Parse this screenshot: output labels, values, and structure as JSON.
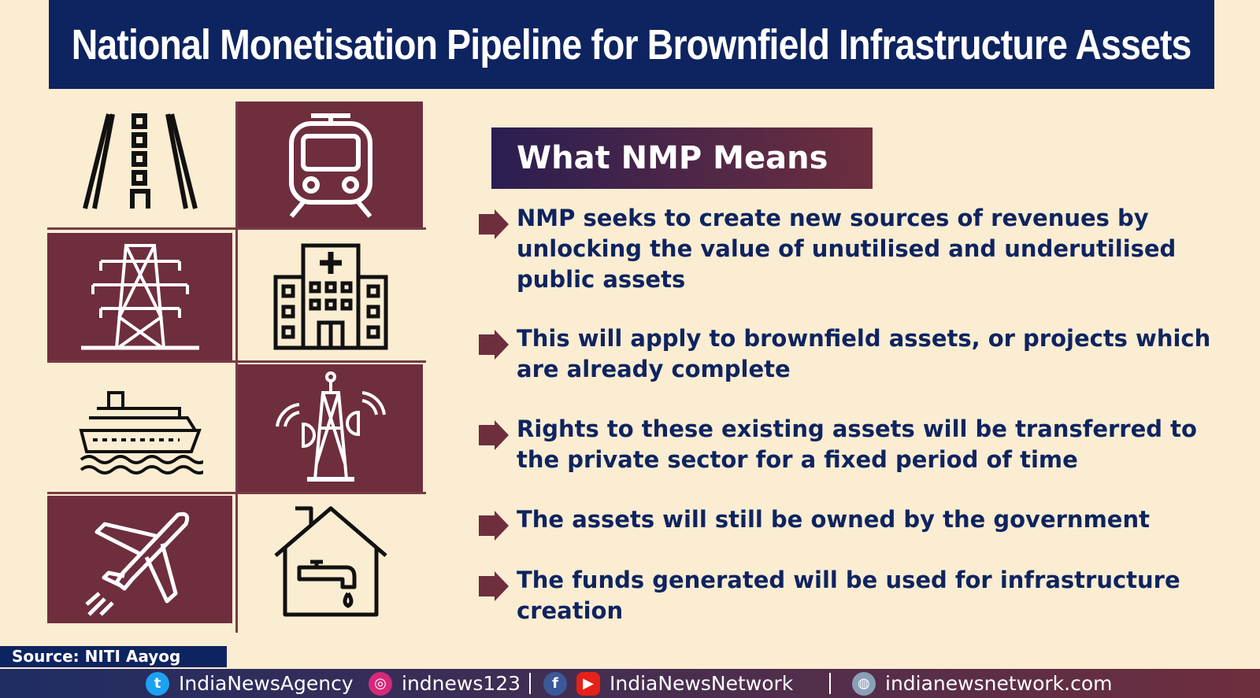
{
  "title": "National Monetisation Pipeline for Brownfield Infrastructure Assets",
  "section_heading": "What NMP Means",
  "points": [
    "NMP seeks to create new sources of revenues by unlocking the value of  unutilised and underutilised public assets",
    "This will apply to brownfield assets, or projects which are already complete",
    "Rights to these existing assets will be transferred to the private sector for a fixed period of time",
    "The assets will still be owned by the government",
    "The funds generated will be used for infrastructure creation"
  ],
  "icons": [
    "road-icon",
    "train-icon",
    "power-tower-icon",
    "hospital-icon",
    "ship-icon",
    "telecom-tower-icon",
    "airplane-icon",
    "house-water-tap-icon"
  ],
  "source": "Source: NITI Aayog",
  "footer": {
    "twitter": "IndiaNewsAgency",
    "instagram": "indnews123",
    "facebook_youtube": "IndiaNewsNetwork",
    "website": "indianewsnetwork.com"
  },
  "colors": {
    "navy": "#0e2460",
    "maroon": "#6e2e3e",
    "cream": "#fbedd2"
  }
}
